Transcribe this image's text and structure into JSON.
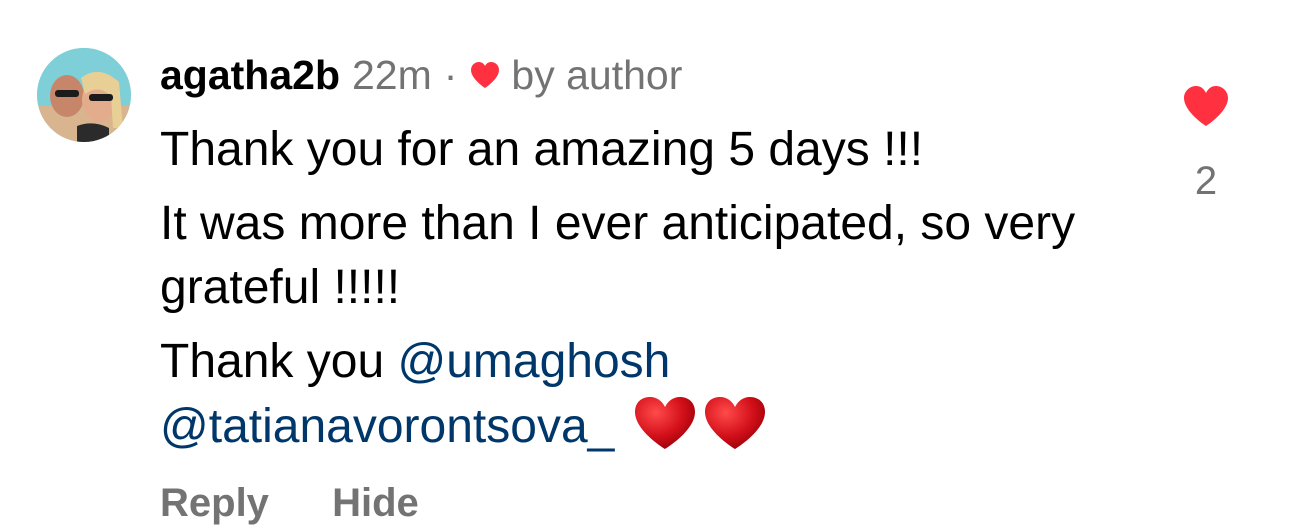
{
  "comment": {
    "username": "agatha2b",
    "time": "22m",
    "separator": "·",
    "author_like_label": "by author",
    "avatar_icon": "profile-photo-icon",
    "paragraphs": {
      "p1": "Thank you for an amazing 5 days !!!",
      "p2": "It was more than I ever anticipated, so very grateful !!!!!",
      "p3_prefix": "Thank you ",
      "mention1": "@umaghosh",
      "mention2": "@tatianavorontsova_"
    },
    "emoji": [
      "red-heart-emoji",
      "red-heart-emoji"
    ],
    "actions": {
      "reply": "Reply",
      "hide": "Hide"
    },
    "like_count": "2"
  },
  "colors": {
    "like_red": "#ff3040",
    "secondary_text": "#737373",
    "mention_blue": "#00376b",
    "emoji_heart": "#d0021b"
  }
}
